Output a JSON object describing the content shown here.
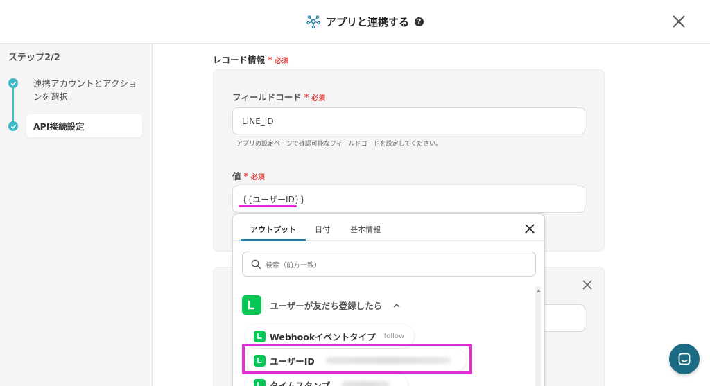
{
  "header": {
    "title": "アプリと連携する",
    "help_glyph": "?"
  },
  "sidebar": {
    "step_label": "ステップ2/2",
    "steps": [
      {
        "label": "連携アカウントとアクションを選択"
      },
      {
        "label": "API接続設定"
      }
    ]
  },
  "section": {
    "title": "レコード情報",
    "required": "必須"
  },
  "field_code": {
    "label": "フィールドコード",
    "required": "必須",
    "value": "LINE_ID",
    "hint": "アプリの設定ページで確認可能なフィールドコードを設定してください。"
  },
  "value_field": {
    "label": "値",
    "required": "必須",
    "value": "{{ユーザーID}}"
  },
  "dropdown": {
    "tabs": [
      {
        "label": "アウトプット"
      },
      {
        "label": "日付"
      },
      {
        "label": "基本情報"
      }
    ],
    "search_placeholder": "検索（前方一致）",
    "group_title": "ユーザーが友だち登録したら",
    "items": [
      {
        "label": "Webhookイベントタイプ",
        "sub": "follow"
      },
      {
        "label": "ユーザーID"
      },
      {
        "label": "タイムスタンプ"
      }
    ]
  },
  "colors": {
    "accent": "#3fb8c8",
    "line_green": "#06c755",
    "highlight": "#e22bd1",
    "tab_indicator": "#1f7fa6",
    "chat_button": "#1b6b84"
  }
}
